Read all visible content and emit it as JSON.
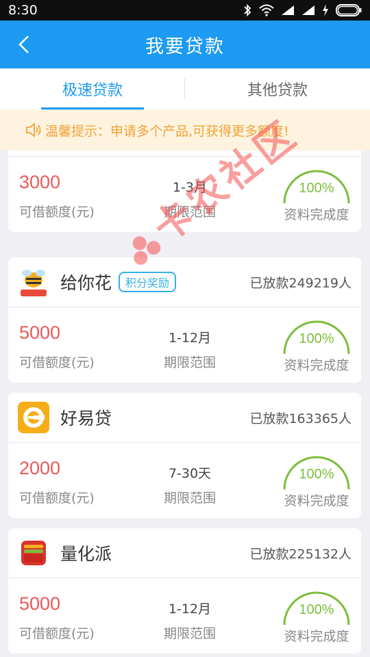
{
  "status_bar": {
    "time": "8:30"
  },
  "header": {
    "title": "我要贷款"
  },
  "tabs": [
    {
      "label": "极速贷款",
      "active": true
    },
    {
      "label": "其他贷款",
      "active": false
    }
  ],
  "notice": {
    "text": "温馨提示：申请多个产品,可获得更多额度!"
  },
  "labels": {
    "amount": "可借额度(元)",
    "period": "期限范围",
    "completion": "资料完成度"
  },
  "products": [
    {
      "name": "",
      "amount": "3000",
      "period": "1-3月",
      "completion": "100%",
      "progress": 1.0,
      "partial": true
    },
    {
      "name": "给你花",
      "badge": "积分奖励",
      "lent": "已放款249219人",
      "amount": "5000",
      "period": "1-12月",
      "completion": "100%",
      "progress": 1.0,
      "icon": "bee-icon"
    },
    {
      "name": "好易贷",
      "lent": "已放款163365人",
      "amount": "2000",
      "period": "7-30天",
      "completion": "100%",
      "progress": 1.0,
      "icon": "hyd-logo-icon"
    },
    {
      "name": "量化派",
      "lent": "已放款225132人",
      "amount": "5000",
      "period": "1-12月",
      "completion": "100%",
      "progress": 1.0,
      "icon": "wallet-icon"
    }
  ],
  "watermark": {
    "text": "卡农社区"
  },
  "colors": {
    "primary": "#1d9af1",
    "amount": "#e85a5a",
    "gauge": "#7cbd3c",
    "notice": "#f2a336"
  }
}
